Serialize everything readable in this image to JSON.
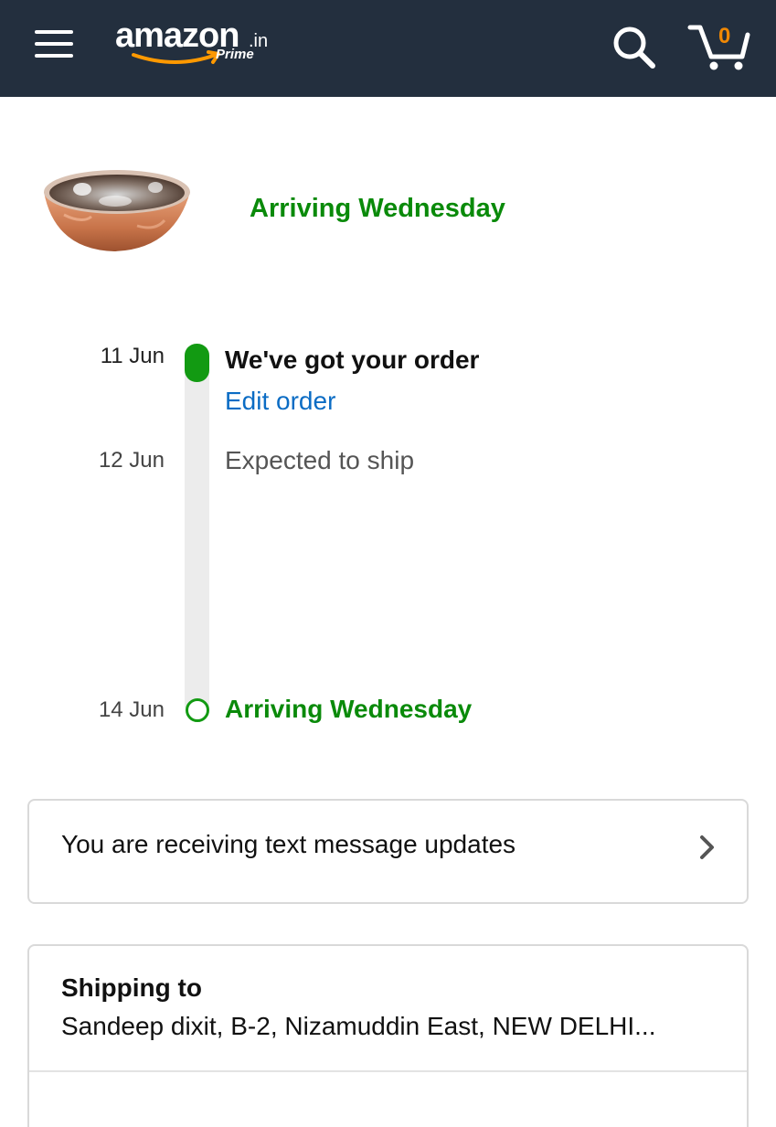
{
  "header": {
    "logo_word": "amazon",
    "logo_suffix": ".in",
    "logo_tag": "Prime",
    "cart_count": "0",
    "background_color": "#232f3e",
    "menu_icon": "hamburger-icon",
    "search_icon": "search-icon",
    "cart_icon": "cart-icon"
  },
  "product": {
    "image": "copper-bowl-image",
    "arrival_text": "Arriving Wednesday"
  },
  "timeline": {
    "steps": [
      {
        "date": "11 Jun",
        "title": "We've got your order",
        "link": "Edit order",
        "status": "complete"
      },
      {
        "date": "12 Jun",
        "title": "Expected to ship",
        "status": "pending"
      },
      {
        "date": "14 Jun",
        "title": "Arriving Wednesday",
        "status": "upcoming"
      }
    ],
    "accent_color": "#129a12"
  },
  "sms_updates": {
    "text": "You are receiving text message updates",
    "icon": "chevron-right-icon"
  },
  "shipping": {
    "label": "Shipping to",
    "address": "Sandeep dixit, B-2, Nizamuddin East, NEW DELHI..."
  }
}
